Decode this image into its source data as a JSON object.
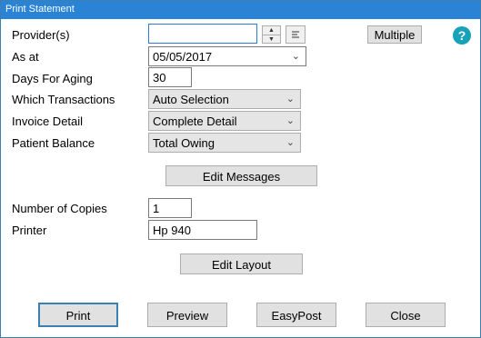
{
  "window": {
    "title": "Print Statement"
  },
  "fields": {
    "providers": {
      "label": "Provider(s)",
      "value": ""
    },
    "as_at": {
      "label": "As at",
      "value": "05/05/2017"
    },
    "days_for_aging": {
      "label": "Days For Aging",
      "value": "30"
    },
    "which_transactions": {
      "label": "Which Transactions",
      "value": "Auto Selection"
    },
    "invoice_detail": {
      "label": "Invoice Detail",
      "value": "Complete Detail"
    },
    "patient_balance": {
      "label": "Patient Balance",
      "value": "Total Owing"
    },
    "number_of_copies": {
      "label": "Number of Copies",
      "value": "1"
    },
    "printer": {
      "label": "Printer",
      "value": "Hp 940"
    }
  },
  "buttons": {
    "multiple": "Multiple",
    "edit_messages": "Edit Messages",
    "edit_layout": "Edit Layout",
    "print": "Print",
    "preview": "Preview",
    "easypost": "EasyPost",
    "close": "Close"
  },
  "icons": {
    "help": "?",
    "spin_up": "▲",
    "spin_down": "▼",
    "dropdown": "⌄"
  },
  "colors": {
    "titlebar": "#2b83d6",
    "help_icon": "#16a2b8",
    "default_button_border": "#3c7fb1"
  }
}
